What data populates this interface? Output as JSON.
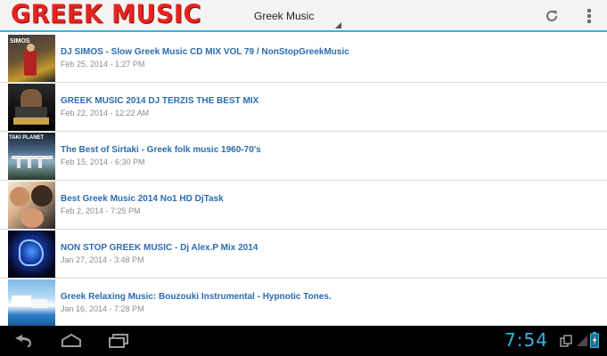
{
  "app": {
    "logo_text": "GREEK MUSIC",
    "spinner_value": "Greek Music"
  },
  "icons": {
    "refresh": "refresh-icon",
    "overflow": "overflow-menu-icon",
    "back": "back-icon",
    "home": "home-icon",
    "recents": "recents-icon"
  },
  "items": [
    {
      "title": "DJ SIMOS - Slow Greek Music CD MIX VOL 79 / NonStopGreekMusic",
      "date": "Feb 25, 2014 - 1:27 PM",
      "thumb_text": "SIMOS"
    },
    {
      "title": "GREEK MUSIC 2014 DJ TERZIS THE BEST MIX",
      "date": "Feb 22, 2014 - 12:22 AM",
      "thumb_text": ""
    },
    {
      "title": "The Best of Sirtaki - Greek folk music 1960-70's",
      "date": "Feb 15, 2014 - 6:30 PM",
      "thumb_text": "TAKI PLANET"
    },
    {
      "title": "Best Greek Music 2014 No1 HD DjTask",
      "date": "Feb 2, 2014 - 7:25 PM",
      "thumb_text": ""
    },
    {
      "title": "NON STOP GREEK MUSIC - Dj Alex.P Mix 2014",
      "date": "Jan 27, 2014 - 3:48 PM",
      "thumb_text": ""
    },
    {
      "title": "Greek Relaxing Music: Bouzouki Instrumental - Hypnotic Tones.",
      "date": "Jan 16, 2014 - 7:28 PM",
      "thumb_text": ""
    }
  ],
  "status": {
    "clock": "7:54"
  },
  "colors": {
    "accent": "#33b5e5",
    "logo": "#e52420",
    "title": "#2b6cb0"
  }
}
